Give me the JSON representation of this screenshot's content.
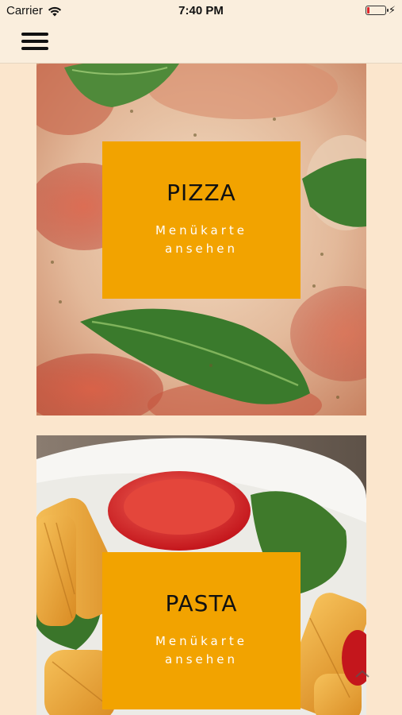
{
  "status_bar": {
    "carrier": "Carrier",
    "time": "7:40 PM",
    "battery_level_percent": 15,
    "battery_color": "#e0262b",
    "icons": [
      "wifi-icon",
      "battery-icon",
      "charging-bolt-icon"
    ]
  },
  "header": {
    "menu_icon": "hamburger-menu-icon"
  },
  "categories": [
    {
      "title": "PIZZA",
      "link_line1": "Menükarte",
      "link_line2": "ansehen",
      "image": "pizza-photo"
    },
    {
      "title": "PASTA",
      "link_line1": "Menükarte",
      "link_line2": "ansehen",
      "image": "pasta-photo"
    }
  ],
  "colors": {
    "page_background": "#fbe6cd",
    "header_background": "#faeedd",
    "overlay_accent": "#f2a300",
    "title_text": "#111111",
    "link_text": "#ffffff"
  }
}
